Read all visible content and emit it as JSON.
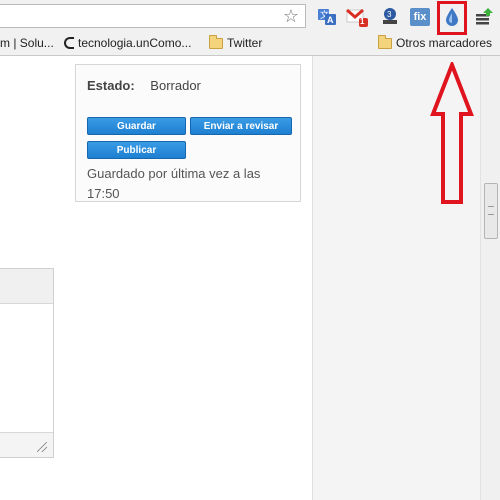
{
  "toolbar": {
    "extensions": [
      {
        "name": "translate-icon"
      },
      {
        "name": "gmail-icon",
        "badge": "1"
      },
      {
        "name": "tag-icon"
      },
      {
        "name": "fix-icon",
        "label": "fix"
      },
      {
        "name": "droplet-icon"
      },
      {
        "name": "menu-icon"
      }
    ]
  },
  "bookmarks": [
    {
      "label": "m | Solu..."
    },
    {
      "label": "tecnologia.unComo..."
    },
    {
      "label": "Twitter"
    },
    {
      "label": "Otros marcadores"
    }
  ],
  "publish_box": {
    "status_label": "Estado:",
    "status_value": "Borrador",
    "save_button": "Guardar",
    "review_button": "Enviar a revisar",
    "publish_button": "Publicar",
    "saved_text": "Guardado por última vez a las 17:50"
  },
  "colors": {
    "highlight": "#e0141e",
    "button": "#1e7fd1"
  }
}
